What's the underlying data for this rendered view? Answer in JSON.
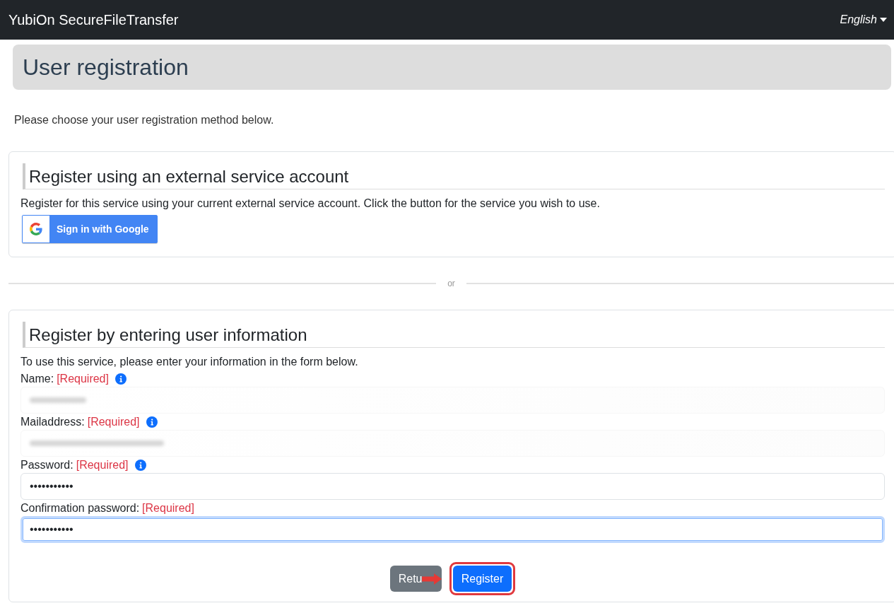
{
  "navbar": {
    "brand": "YubiOn SecureFileTransfer",
    "language": "English"
  },
  "page_title": "User registration",
  "intro": "Please choose your user registration method below.",
  "external_section": {
    "heading": "Register using an external service account",
    "description": "Register for this service using your current external service account. Click the button for the service you wish to use.",
    "sign_in_button": "Sign in with Google"
  },
  "divider": "or",
  "form_section": {
    "heading": "Register by entering user information",
    "description": "To use this service, please enter your information in the form below.",
    "fields": [
      {
        "label": "Name:",
        "required": "[Required]",
        "info": true,
        "kind": "text",
        "redacted": true,
        "focused": false
      },
      {
        "label": "Mailaddress:",
        "required": "[Required]",
        "info": true,
        "kind": "email",
        "redacted": true,
        "focused": false
      },
      {
        "label": "Password:",
        "required": "[Required]",
        "info": true,
        "kind": "password",
        "value": "•••••••••••",
        "redacted": false,
        "focused": false
      },
      {
        "label": "Confirmation password:",
        "required": "[Required]",
        "info": false,
        "kind": "password",
        "value": "•••••••••••",
        "redacted": false,
        "focused": true
      }
    ],
    "buttons": [
      {
        "label": "Retu",
        "kind": "secondary",
        "highlighted": false
      },
      {
        "label": "Register",
        "kind": "primary",
        "highlighted": true
      }
    ]
  }
}
